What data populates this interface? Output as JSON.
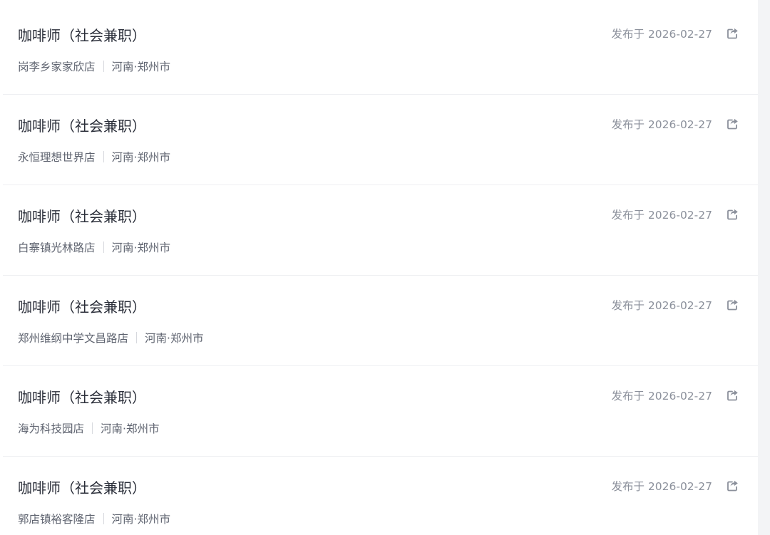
{
  "share_icon": "share-icon",
  "jobs": [
    {
      "title": "咖啡师（社会兼职）",
      "store": "岗李乡家家欣店",
      "location": "河南·郑州市",
      "date": "发布于 2026-02-27"
    },
    {
      "title": "咖啡师（社会兼职）",
      "store": "永恒理想世界店",
      "location": "河南·郑州市",
      "date": "发布于 2026-02-27"
    },
    {
      "title": "咖啡师（社会兼职）",
      "store": "白寨镇光林路店",
      "location": "河南·郑州市",
      "date": "发布于 2026-02-27"
    },
    {
      "title": "咖啡师（社会兼职）",
      "store": "郑州维纲中学文昌路店",
      "location": "河南·郑州市",
      "date": "发布于 2026-02-27"
    },
    {
      "title": "咖啡师（社会兼职）",
      "store": "海为科技园店",
      "location": "河南·郑州市",
      "date": "发布于 2026-02-27"
    },
    {
      "title": "咖啡师（社会兼职）",
      "store": "郭店镇裕客隆店",
      "location": "河南·郑州市",
      "date": "发布于 2026-02-27"
    }
  ]
}
